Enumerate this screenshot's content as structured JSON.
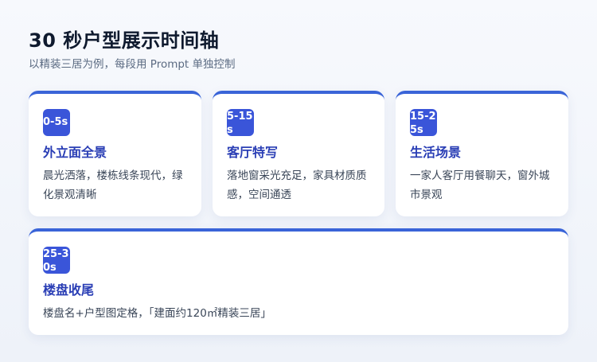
{
  "header": {
    "title": "30 秒户型展示时间轴",
    "subtitle": "以精装三居为例，每段用 Prompt 单独控制"
  },
  "segments": [
    {
      "time": "0-5s",
      "title": "外立面全景",
      "desc": "晨光洒落，楼栋线条现代，绿化景观清晰"
    },
    {
      "time": "5-15s",
      "title": "客厅特写",
      "desc": "落地窗采光充足，家具材质质感，空间通透"
    },
    {
      "time": "15-25s",
      "title": "生活场景",
      "desc": "一家人客厅用餐聊天，窗外城市景观"
    },
    {
      "time": "25-30s",
      "title": "楼盘收尾",
      "desc": "楼盘名+户型图定格，「建面约120㎡精装三居」"
    }
  ],
  "colors": {
    "accent": "#3a64d8",
    "badge": "#3a55d9",
    "card_title": "#2a3eb5"
  }
}
